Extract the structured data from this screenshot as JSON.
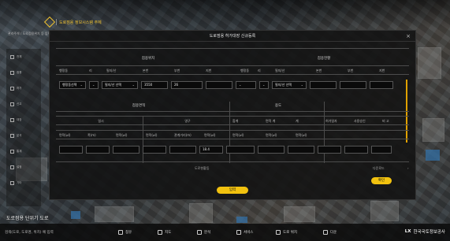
{
  "app": {
    "logo_text": "도로점용 정보시스템 주제",
    "search_hint": "관리주체 / 도로점용위치 등 입력",
    "caption": "도로점용 단위기 도로",
    "bottom_search": "검색(도로, 도로명, 위치) 예 입력",
    "bottom_items": [
      "점유",
      "지도",
      "분석",
      "서비스",
      "도로 위치",
      "다운"
    ],
    "brand_lx": "LX",
    "brand_name": "한국국토정보공사"
  },
  "sidebar": {
    "rows": [
      "전체",
      "점용",
      "허가",
      "신고",
      "대장",
      "분석",
      "통계",
      "설정",
      "기타"
    ]
  },
  "modal": {
    "title": "도로점용 허가대장 신규등록",
    "close_icon": "×",
    "section_location": "점용위치",
    "section_right": "점용현황",
    "loc_headers": [
      "행정동",
      "리",
      "필지/산",
      "본번",
      "부번",
      "지번"
    ],
    "right_headers": [
      "행정동",
      "리",
      "필지/산",
      "본번",
      "부번",
      "지번"
    ],
    "row1_inputs": {
      "dong": "행정동선택",
      "ri": "",
      "sanji": "필지/산 선택",
      "bonbun": "3550",
      "bubun": "26",
      "jibun": "",
      "r_dong": "",
      "r_sanji": "필지/산 선택",
      "r_bon": "",
      "r_bu": "",
      "r_ji": ""
    },
    "section_area": "점용면적",
    "section_far": "용도",
    "area_groups": [
      "일시",
      "영구",
      "합계",
      "면적 계",
      "계",
      "허가일자",
      "사용승인",
      "비 고"
    ],
    "area_headers": [
      "면적(㎡)",
      "폭(m)",
      "면적(㎡)",
      "면적(㎡)",
      "관계거리(m)",
      "면적(㎡)",
      "면적(㎡)",
      "면적(㎡)",
      "면적(㎡)"
    ],
    "area_value": "18.4",
    "footer_left": "도로현황등",
    "footer_right": "다운로드",
    "confirm_label": "확인",
    "save_label": "입력"
  },
  "colors": {
    "accent": "#f2c20f",
    "scroll": "#e0a100"
  }
}
